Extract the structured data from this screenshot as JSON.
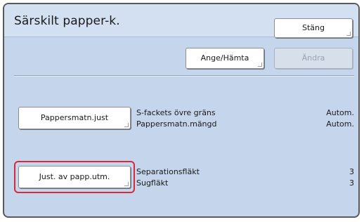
{
  "header": {
    "title": "Särskilt papper-k.",
    "close_label": "Stäng"
  },
  "toolbar": {
    "ange_label": "Ange/Hämta",
    "andra_label": "Ändra",
    "andra_enabled": false
  },
  "groups": [
    {
      "button_label": "Pappersmatn.just",
      "selected": false,
      "settings": [
        {
          "label": "S-fackets övre gräns",
          "value": "Autom."
        },
        {
          "label": "Pappersmatn.mängd",
          "value": "Autom."
        }
      ]
    },
    {
      "button_label": "Just. av papp.utm.",
      "selected": true,
      "settings": [
        {
          "label": "Separationsfläkt",
          "value": "3"
        },
        {
          "label": "Sugfläkt",
          "value": "3"
        }
      ]
    }
  ],
  "colors": {
    "background": "#c5d6ec",
    "selection_outline": "#d62b3a",
    "disabled_text": "#98a3b0"
  }
}
